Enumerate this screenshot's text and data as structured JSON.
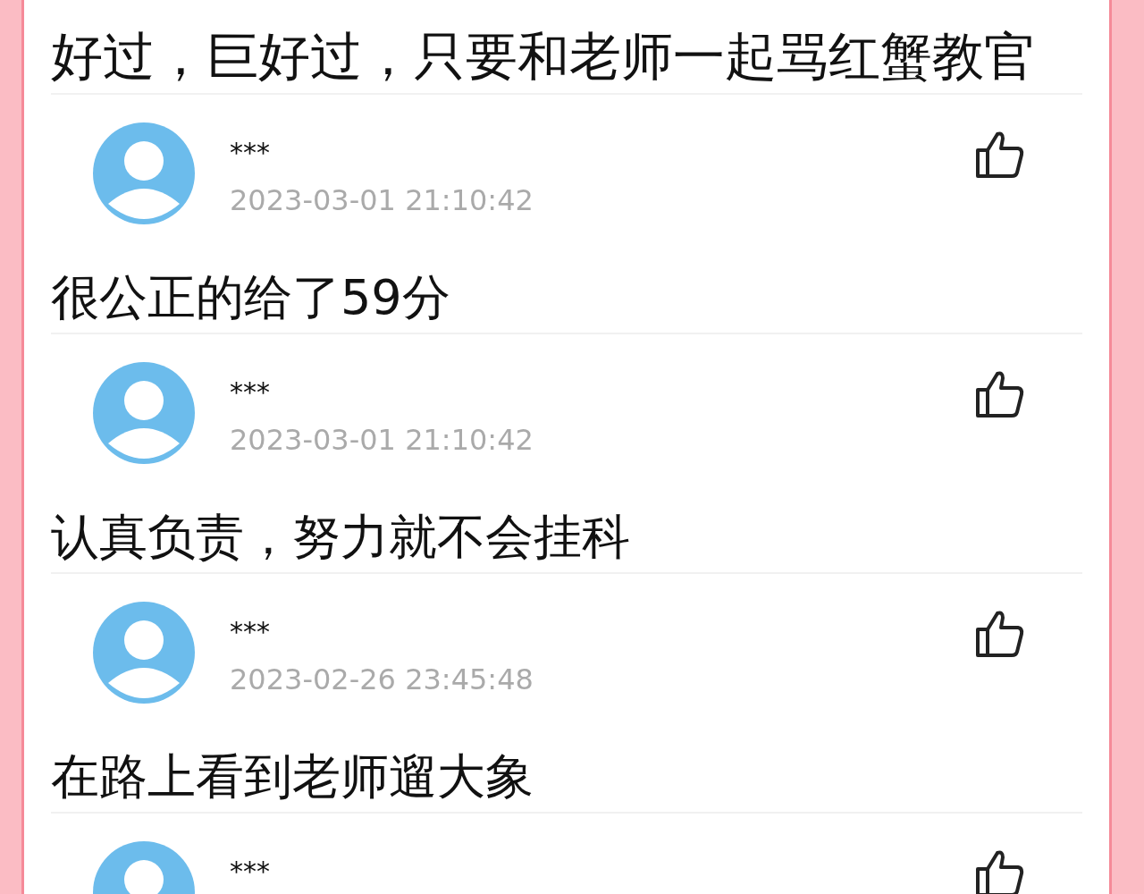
{
  "top_comment": "好过，巨好过，只要和老师一起骂红蟹教官",
  "comments": [
    {
      "user": "***",
      "time": "2023-03-01 21:10:42",
      "caption": "很公正的给了59分"
    },
    {
      "user": "***",
      "time": "2023-03-01 21:10:42",
      "caption": "认真负责，努力就不会挂科"
    },
    {
      "user": "***",
      "time": "2023-02-26 23:45:48",
      "caption": "在路上看到老师遛大象"
    },
    {
      "user": "***"
    }
  ]
}
